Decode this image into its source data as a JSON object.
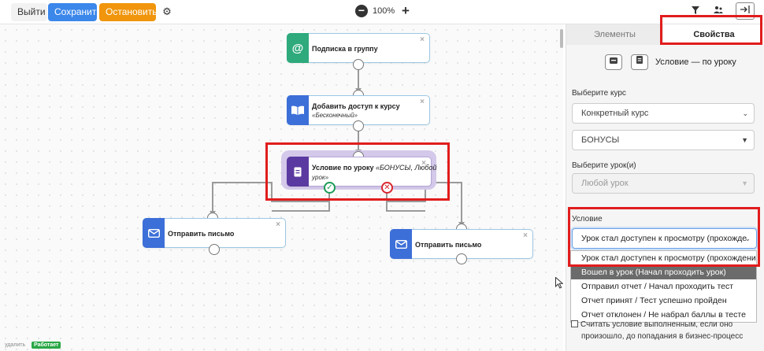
{
  "toolbar": {
    "exit_label": "Выйти",
    "save_label": "Сохранить",
    "stop_label": "Остановить",
    "zoom_minus": "−",
    "zoom_level": "100%",
    "zoom_plus": "+",
    "colors": {
      "save": "#3b87ea",
      "stop": "#f0950c"
    },
    "icons": [
      "gear-icon",
      "filter-icon",
      "users-icon",
      "collapse-panel-icon"
    ]
  },
  "canvas": {
    "nodes": {
      "subscribe": {
        "title": "Подписка в группу",
        "icon": "@",
        "color": "#2eaa7d"
      },
      "access": {
        "title": "Добавить доступ к курсу",
        "subtitle": "«Бесконечный»",
        "icon": "book-icon",
        "color": "#3d6fd8"
      },
      "condition": {
        "title": "Условие по уроку",
        "subtitle_inline": "«БОНУСЫ, Любой",
        "subtitle_line2": "урок»",
        "icon": "lesson-icon",
        "color": "#5a3aa0"
      },
      "send_left": {
        "title": "Отправить письмо",
        "icon": "mail-icon",
        "color": "#3d6fd8"
      },
      "send_right": {
        "title": "Отправить письмо",
        "icon": "mail-icon",
        "color": "#3d6fd8"
      }
    },
    "close_glyph": "×",
    "ok_glyph": "✓",
    "no_glyph": "✕",
    "footer_text": "удалить",
    "footer_badge": "Работает"
  },
  "panel": {
    "tabs": {
      "elements": "Элементы",
      "properties": "Свойства"
    },
    "heading": "Условие — по уроку",
    "course_label": "Выберите курс",
    "course_type": "Конкретный курс",
    "course_value": "БОНУСЫ",
    "lesson_label": "Выберите урок(и)",
    "lesson_placeholder": "Любой урок",
    "condition_label": "Условие",
    "condition_value": "Урок стал доступен к просмотру (прохожде",
    "condition_options": [
      "Урок стал доступен к просмотру (прохождению)",
      "Вошел в урок (Начал проходить урок)",
      "Отправил отчет / Начал проходить тест",
      "Отчет принят / Тест успешно пройден",
      "Отчет отклонен / Не набрал баллы в тесте"
    ],
    "condition_selected_index": 1,
    "checkbox_line1": "Считать условие выполненным, если оно",
    "checkbox_line2": "произошло, до попадания в бизнес-процесс"
  }
}
